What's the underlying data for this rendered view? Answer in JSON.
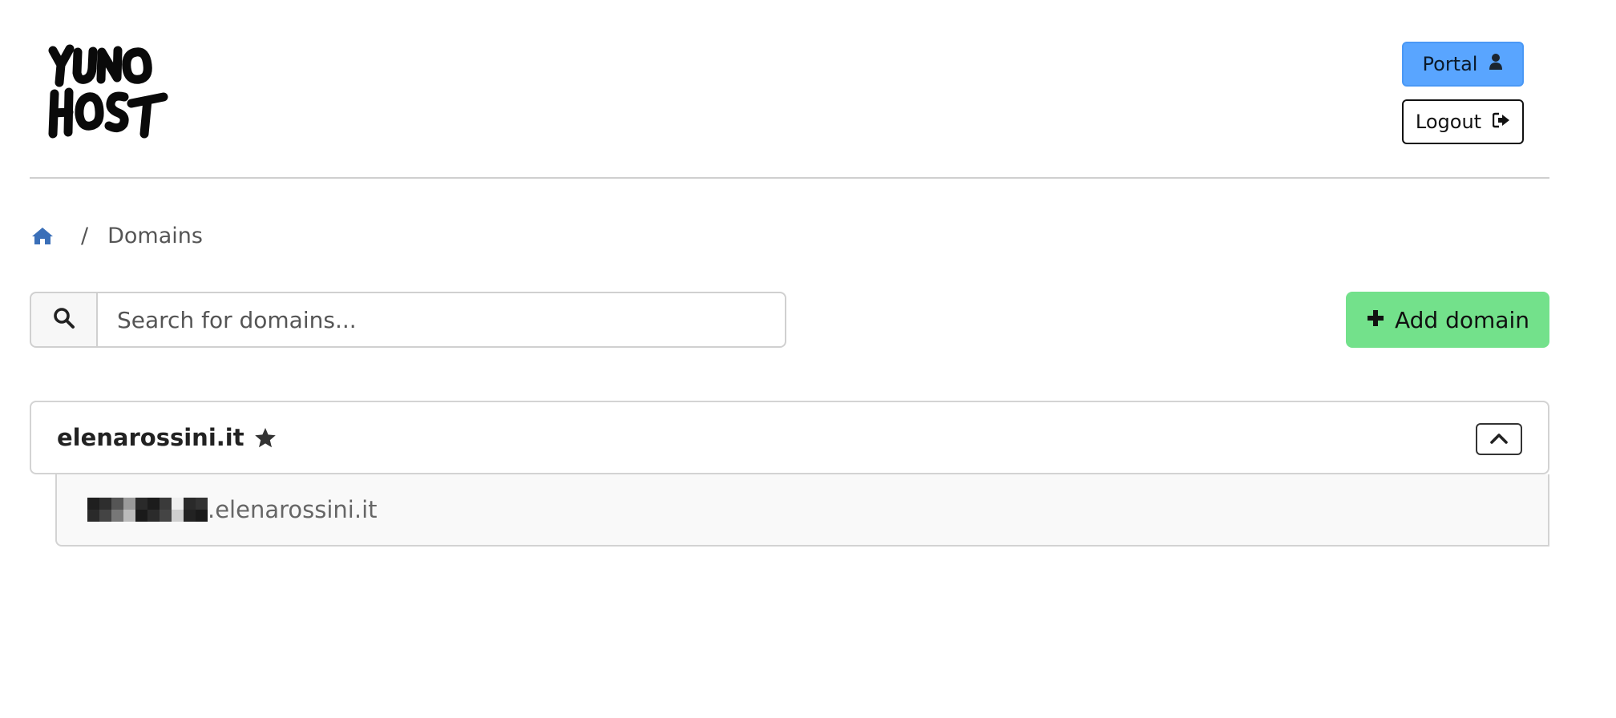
{
  "header": {
    "logo_text": "YUNO HOST",
    "portal_label": "Portal",
    "logout_label": "Logout"
  },
  "breadcrumb": {
    "current": "Domains"
  },
  "search": {
    "placeholder": "Search for domains..."
  },
  "actions": {
    "add_domain_label": "Add domain"
  },
  "domains": [
    {
      "name": "elenarossini.it",
      "is_main": true,
      "subdomains": [
        {
          "suffix": ".elenarossini.it",
          "prefix_redacted": true
        }
      ]
    }
  ],
  "colors": {
    "portal_bg": "#59a5ff",
    "add_bg": "#73e18b",
    "home_icon": "#3a6fb8"
  },
  "icons": {
    "portal": "user-icon",
    "logout": "sign-out-icon",
    "home": "home-icon",
    "search": "search-icon",
    "add": "plus-icon",
    "main_domain": "star-icon",
    "collapse": "chevron-up-icon"
  }
}
